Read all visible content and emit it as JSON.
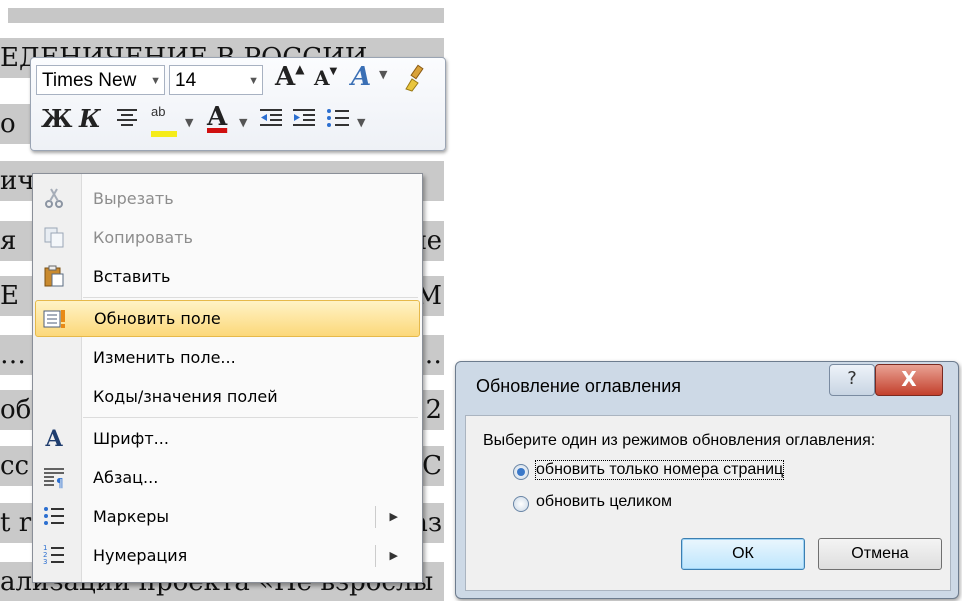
{
  "document": {
    "lines": [
      {
        "left": "ЕДЕНИЧЕНИЕ В РОССИИ",
        "right": "..."
      },
      {
        "left": "о",
        "right": "..."
      },
      {
        "left": "ичная деятельность пользо",
        "right": ""
      },
      {
        "left": "я",
        "right": "ле"
      },
      {
        "left": "Е",
        "right": "М"
      },
      {
        "left": "…",
        "right": "…"
      },
      {
        "left": "об",
        "right": "2"
      },
      {
        "left": "сс",
        "right": "С"
      },
      {
        "left": "t r",
        "right": "аз"
      },
      {
        "left": "ализации проекта «Не взрослы",
        "right": ""
      }
    ]
  },
  "mini_toolbar": {
    "font_name": "Times New",
    "font_size": "14",
    "bold_glyph": "Ж",
    "italic_glyph": "К",
    "grow_font_glyph": "A",
    "shrink_font_glyph": "A",
    "font_color_glyph": "A",
    "highlight_glyph": "ab",
    "styles_glyph": "A"
  },
  "context_menu": {
    "items": [
      {
        "label": "Вырезать",
        "disabled": true,
        "icon": "scissors-icon"
      },
      {
        "label": "Копировать",
        "disabled": true,
        "icon": "copy-icon"
      },
      {
        "label": "Вставить",
        "disabled": false,
        "icon": "paste-icon"
      },
      {
        "label": "Обновить поле",
        "disabled": false,
        "highlighted": true,
        "icon": "update-field-icon"
      },
      {
        "label": "Изменить поле...",
        "disabled": false,
        "icon": ""
      },
      {
        "label": "Коды/значения полей",
        "disabled": false,
        "icon": ""
      },
      {
        "label": "Шрифт...",
        "disabled": false,
        "icon": "font-icon",
        "glyph": "A"
      },
      {
        "label": "Абзац...",
        "disabled": false,
        "icon": "paragraph-icon"
      },
      {
        "label": "Маркеры",
        "disabled": false,
        "icon": "bullets-icon",
        "submenu": true
      },
      {
        "label": "Нумерация",
        "disabled": false,
        "icon": "numbering-icon",
        "submenu": true
      }
    ]
  },
  "dialog": {
    "title": "Обновление оглавления",
    "help_glyph": "?",
    "close_glyph": "X",
    "message": "Выберите один из режимов обновления оглавления:",
    "options": [
      {
        "label": "обновить только номера страниц",
        "selected": true
      },
      {
        "label": "обновить целиком",
        "selected": false
      }
    ],
    "ok_label": "ОК",
    "cancel_label": "Отмена"
  }
}
